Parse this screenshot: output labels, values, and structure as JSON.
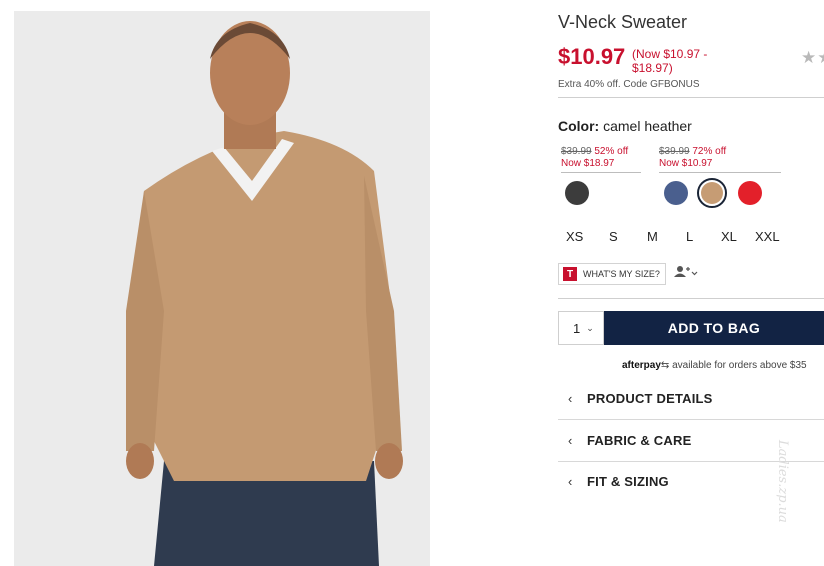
{
  "product": {
    "title": "V-Neck Sweater",
    "price": "$10.97",
    "price_range": "(Now $10.97 - $18.97)",
    "rating_stars": "★★",
    "promo": "Extra 40% off. Code GFBONUS"
  },
  "color": {
    "label": "Color:",
    "value": "camel heather",
    "price_groups": [
      {
        "original": "$39.99",
        "discount": "52% off",
        "now": "Now $18.97"
      },
      {
        "original": "$39.99",
        "discount": "72% off",
        "now": "Now $10.97"
      }
    ],
    "swatches": [
      {
        "name": "charcoal",
        "hex": "#3c3c3c"
      },
      {
        "name": "blue",
        "hex": "#4a5f8e"
      },
      {
        "name": "camel heather",
        "hex": "#c69c74",
        "selected": true
      },
      {
        "name": "red",
        "hex": "#e3202a"
      }
    ]
  },
  "sizes": [
    "XS",
    "S",
    "M",
    "L",
    "XL",
    "XXL"
  ],
  "fit_tool": {
    "badge": "T",
    "label": "WHAT'S MY SIZE?",
    "icon": "person-plus-icon"
  },
  "cart": {
    "quantity": "1",
    "add_label": "ADD TO BAG"
  },
  "afterpay": {
    "brand": "afterpay",
    "text": "available for orders above $35"
  },
  "accordion": [
    "PRODUCT DETAILS",
    "FABRIC & CARE",
    "FIT & SIZING"
  ],
  "colors": {
    "sale_red": "#c8102e",
    "navy_button": "#122344"
  },
  "watermark": "Ladies.zp.ua"
}
